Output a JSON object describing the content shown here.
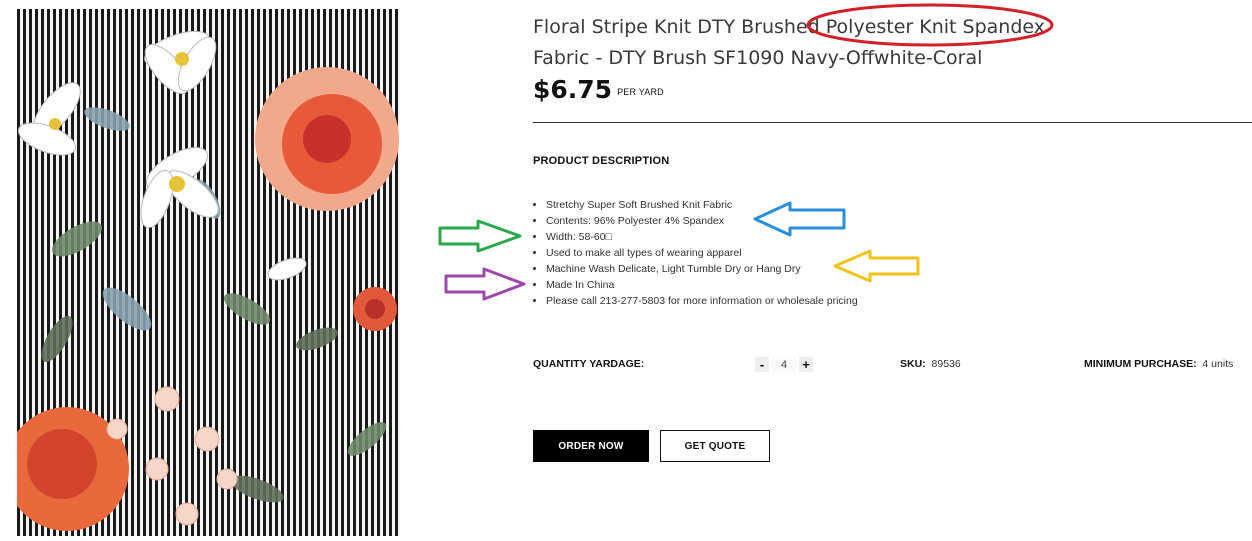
{
  "product": {
    "title_line1": "Floral Stripe Knit DTY Brushed Polyester Knit Spandex",
    "title_line2": "Fabric - DTY Brush SF1090 Navy-Offwhite-Coral",
    "price": "$6.75",
    "price_unit": "PER YARD",
    "image_alt": "Floral stripe knit fabric swatch"
  },
  "description": {
    "heading": "PRODUCT DESCRIPTION",
    "items": [
      "Stretchy Super Soft Brushed Knit Fabric",
      "Contents: 96% Polyester 4% Spandex",
      "Width: 58-60□",
      "Used to make all types of wearing apparel",
      "Machine Wash Delicate, Light Tumble Dry or Hang Dry",
      "Made In China",
      "Please call 213-277-5803 for more information or wholesale pricing"
    ]
  },
  "purchase": {
    "quantity_label": "QUANTITY YARDAGE:",
    "decrement": "-",
    "increment": "+",
    "quantity_value": "4",
    "sku_label": "SKU:",
    "sku_value": "89536",
    "min_label": "MINIMUM PURCHASE:",
    "min_value": "4 units"
  },
  "actions": {
    "order_label": "ORDER NOW",
    "quote_label": "GET QUOTE"
  },
  "colors": {
    "annotation_red": "#d0202a",
    "annotation_blue": "#2a8fd8",
    "annotation_green": "#2aa84a",
    "annotation_yellow": "#f2c21a",
    "annotation_purple": "#9a4aa8"
  }
}
